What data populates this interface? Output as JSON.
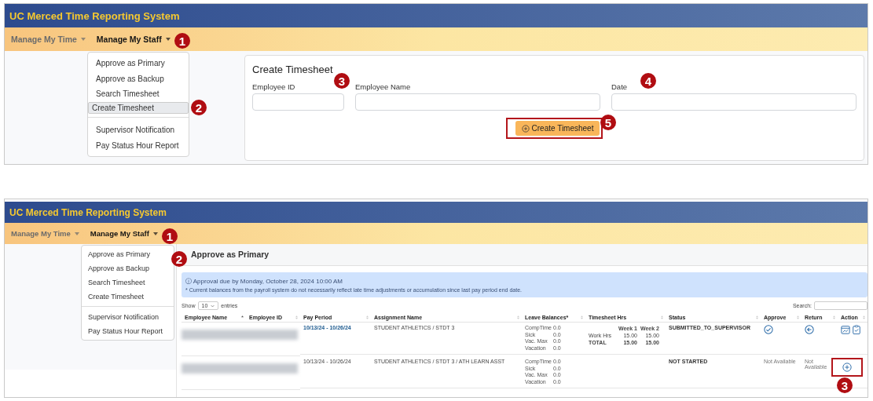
{
  "screens": [
    {
      "kind": "create",
      "app_title": "UC Merced Time Reporting System",
      "nav": [
        {
          "label": "Manage My Time",
          "selected": false
        },
        {
          "label": "Manage My Staff",
          "selected": true
        }
      ],
      "menu": [
        [
          {
            "label": "Approve as Primary",
            "selected": false
          },
          {
            "label": "Approve as Backup",
            "selected": false
          },
          {
            "label": "Search Timesheet",
            "selected": false
          },
          {
            "label": "Create Timesheet",
            "selected": true
          }
        ],
        [
          {
            "label": "Supervisor Notification",
            "selected": false
          },
          {
            "label": "Pay Status Hour Report",
            "selected": false
          }
        ]
      ],
      "form": {
        "title": "Create Timesheet",
        "fields": [
          {
            "label": "Employee ID"
          },
          {
            "label": "Employee Name"
          },
          {
            "label": "Date"
          }
        ],
        "button": "Create Timesheet"
      },
      "callouts": [
        "1",
        "2",
        "3",
        "4",
        "5"
      ]
    },
    {
      "kind": "approve",
      "app_title": "UC Merced Time Reporting System",
      "nav": [
        {
          "label": "Manage My Time",
          "selected": false
        },
        {
          "label": "Manage My Staff",
          "selected": true
        }
      ],
      "menu": [
        [
          {
            "label": "Approve as Primary",
            "selected": false
          },
          {
            "label": "Approve as Backup",
            "selected": false
          },
          {
            "label": "Search Timesheet",
            "selected": false
          },
          {
            "label": "Create Timesheet",
            "selected": false
          }
        ],
        [
          {
            "label": "Supervisor Notification",
            "selected": false
          },
          {
            "label": "Pay Status Hour Report",
            "selected": false
          }
        ]
      ],
      "page_title": "Approve as Primary",
      "alert": {
        "due": "ⓘ Approval due by Monday, October 28, 2024 10:00 AM",
        "note": "* Current balances from the payroll system do not necessarily reflect late time adjustments or accumulation since last pay period end date."
      },
      "show": {
        "label": "Show",
        "value": "10",
        "suffix": "entries"
      },
      "search_label": "Search:",
      "columns": [
        "Employee Name",
        "Employee ID",
        "Pay Period",
        "Assignment Name",
        "Leave Balances*",
        "Timesheet Hrs",
        "Status",
        "Approve",
        "Return",
        "Action"
      ],
      "rows": [
        {
          "pay_period": "10/13/24 - 10/26/24",
          "pay_period_link": true,
          "assignment": "STUDENT ATHLETICS / STDT 3",
          "balances": [
            {
              "label": "CompTime",
              "value": "0.0"
            },
            {
              "label": "Sick",
              "value": "0.0"
            },
            {
              "label": "Vac. Max",
              "value": "0.0"
            },
            {
              "label": "Vacation",
              "value": "0.0"
            }
          ],
          "hours": {
            "weeks": [
              "Week 1",
              "Week 2"
            ],
            "lines": [
              {
                "label": "Work Hrs",
                "values": [
                  "15.00",
                  "15.00"
                ],
                "bold": false
              },
              {
                "label": "TOTAL",
                "values": [
                  "15.00",
                  "15.00"
                ],
                "bold": true
              }
            ]
          },
          "status": "SUBMITTED_TO_SUPERVISOR",
          "approve": {
            "kind": "icon"
          },
          "return": {
            "kind": "icon"
          },
          "action": {
            "kind": "review"
          }
        },
        {
          "pay_period": "10/13/24 - 10/26/24",
          "pay_period_link": false,
          "assignment": "STUDENT ATHLETICS / STDT 3 / ATH LEARN ASST",
          "balances": [
            {
              "label": "CompTime",
              "value": "0.0"
            },
            {
              "label": "Sick",
              "value": "0.0"
            },
            {
              "label": "Vac. Max",
              "value": "0.0"
            },
            {
              "label": "Vacation",
              "value": "0.0"
            }
          ],
          "status": "NOT STARTED",
          "approve": {
            "kind": "text",
            "text": "Not Available"
          },
          "return": {
            "kind": "text",
            "text": "Not Available"
          },
          "action": {
            "kind": "create"
          }
        }
      ],
      "callouts": [
        "1",
        "2",
        "3"
      ]
    }
  ]
}
